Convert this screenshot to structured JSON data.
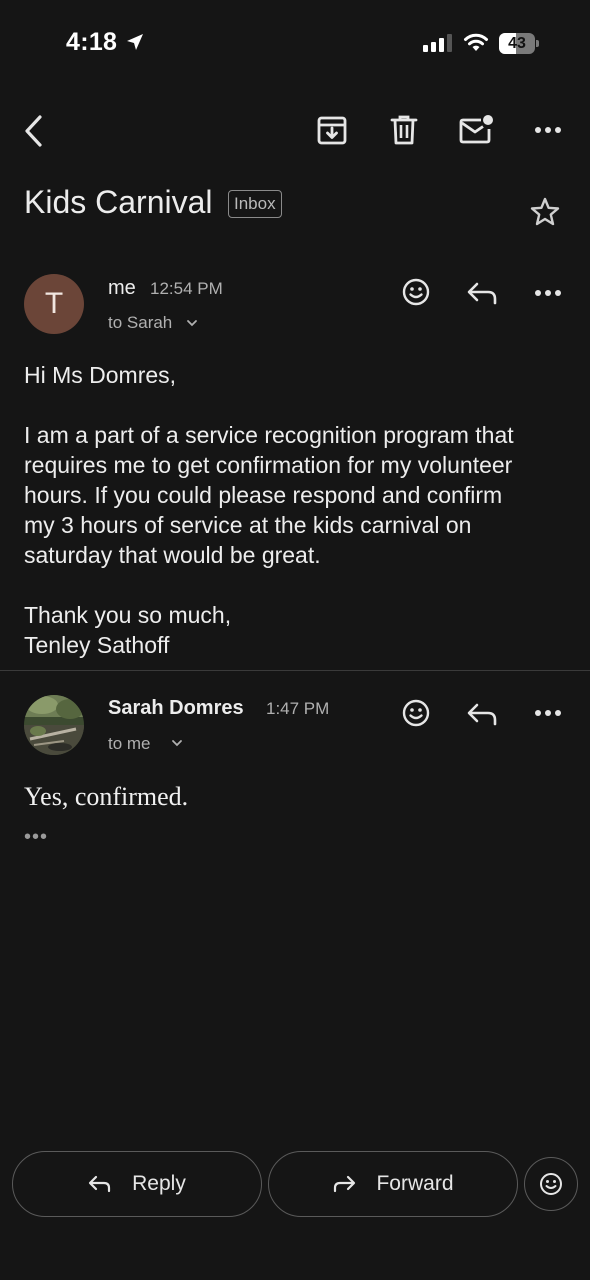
{
  "status_bar": {
    "time": "4:18",
    "battery": "43"
  },
  "toolbar": {
    "back_icon": "chevron-left-icon",
    "archive_icon": "archive-icon",
    "delete_icon": "trash-icon",
    "mark_unread_icon": "mail-unread-icon",
    "more_icon": "more-horizontal-icon"
  },
  "email": {
    "subject": "Kids Carnival",
    "label": "Inbox",
    "star_icon": "star-outline-icon"
  },
  "messages": [
    {
      "avatar_letter": "T",
      "sender": "me",
      "time": "12:54 PM",
      "recipient": "to Sarah",
      "body": [
        "Hi Ms Domres,",
        "I am a part of a service recognition program that",
        "requires me to get confirmation for my volunteer",
        "hours. If you could please respond and confirm",
        "my 3 hours of service at the kids carnival on",
        "saturday that would be great.",
        "Thank you so much,",
        "Tenley Sathoff"
      ]
    },
    {
      "sender": "Sarah Domres",
      "time": "1:47 PM",
      "recipient": "to me",
      "body": "Yes, confirmed.",
      "trimmed_indicator": "•••"
    }
  ],
  "actions": {
    "reply_label": "Reply",
    "forward_label": "Forward"
  },
  "colors": {
    "background": "#151515",
    "avatar_me": "#6b4538",
    "text": "#ededed",
    "muted": "#b0b0b0"
  }
}
